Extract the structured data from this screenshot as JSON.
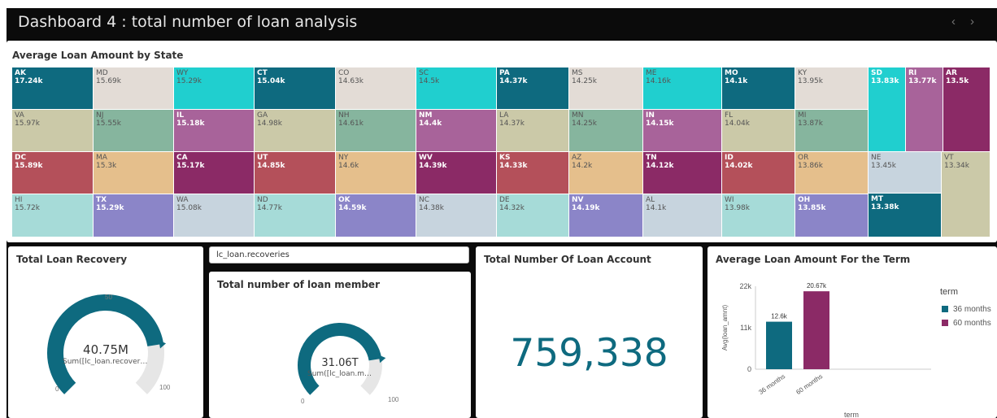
{
  "header": {
    "title": "Dashboard 4 : total number of loan analysis",
    "prev_label": "‹",
    "next_label": "›"
  },
  "colors": {
    "dark_teal": "#0e6a7f",
    "cyan": "#20cfcf",
    "beige": "#e3dcd6",
    "sage": "#86b59e",
    "khaki": "#cbc9a8",
    "mauve": "#a8639a",
    "red": "#b4505a",
    "tan": "#e5bf8c",
    "plum": "#8b2a66",
    "aqua": "#a6dbd8",
    "lavender": "#8b85c8",
    "slate": "#c7d4de",
    "gauge": "#0e6a7f",
    "bar_36": "#0e6a7f",
    "bar_60": "#8b2a66"
  },
  "treemap": {
    "title": "Average Loan Amount by State",
    "tiles": [
      {
        "code": "AK",
        "value": "17.24k",
        "color": "#0e6a7f",
        "dark": true
      },
      {
        "code": "MD",
        "value": "15.69k",
        "color": "#e3dcd6",
        "dark": false
      },
      {
        "code": "WY",
        "value": "15.29k",
        "color": "#20cfcf",
        "dark": false
      },
      {
        "code": "CT",
        "value": "15.04k",
        "color": "#0e6a7f",
        "dark": true
      },
      {
        "code": "CO",
        "value": "14.63k",
        "color": "#e3dcd6",
        "dark": false
      },
      {
        "code": "SC",
        "value": "14.5k",
        "color": "#20cfcf",
        "dark": false
      },
      {
        "code": "PA",
        "value": "14.37k",
        "color": "#0e6a7f",
        "dark": true
      },
      {
        "code": "MS",
        "value": "14.25k",
        "color": "#e3dcd6",
        "dark": false
      },
      {
        "code": "ME",
        "value": "14.16k",
        "color": "#20cfcf",
        "dark": false
      },
      {
        "code": "MO",
        "value": "14.1k",
        "color": "#0e6a7f",
        "dark": true
      },
      {
        "code": "KY",
        "value": "13.95k",
        "color": "#e3dcd6",
        "dark": false
      },
      {
        "code": "VA",
        "value": "15.97k",
        "color": "#cbc9a8",
        "dark": false
      },
      {
        "code": "NJ",
        "value": "15.55k",
        "color": "#86b59e",
        "dark": false
      },
      {
        "code": "IL",
        "value": "15.18k",
        "color": "#a8639a",
        "dark": true
      },
      {
        "code": "GA",
        "value": "14.98k",
        "color": "#cbc9a8",
        "dark": false
      },
      {
        "code": "NH",
        "value": "14.61k",
        "color": "#86b59e",
        "dark": false
      },
      {
        "code": "NM",
        "value": "14.4k",
        "color": "#a8639a",
        "dark": true
      },
      {
        "code": "LA",
        "value": "14.37k",
        "color": "#cbc9a8",
        "dark": false
      },
      {
        "code": "MN",
        "value": "14.25k",
        "color": "#86b59e",
        "dark": false
      },
      {
        "code": "IN",
        "value": "14.15k",
        "color": "#a8639a",
        "dark": true
      },
      {
        "code": "FL",
        "value": "14.04k",
        "color": "#cbc9a8",
        "dark": false
      },
      {
        "code": "MI",
        "value": "13.87k",
        "color": "#86b59e",
        "dark": false
      },
      {
        "code": "DC",
        "value": "15.89k",
        "color": "#b4505a",
        "dark": true
      },
      {
        "code": "MA",
        "value": "15.3k",
        "color": "#e5bf8c",
        "dark": false
      },
      {
        "code": "CA",
        "value": "15.17k",
        "color": "#8b2a66",
        "dark": true
      },
      {
        "code": "UT",
        "value": "14.85k",
        "color": "#b4505a",
        "dark": true
      },
      {
        "code": "NY",
        "value": "14.6k",
        "color": "#e5bf8c",
        "dark": false
      },
      {
        "code": "WV",
        "value": "14.39k",
        "color": "#8b2a66",
        "dark": true
      },
      {
        "code": "KS",
        "value": "14.33k",
        "color": "#b4505a",
        "dark": true
      },
      {
        "code": "AZ",
        "value": "14.2k",
        "color": "#e5bf8c",
        "dark": false
      },
      {
        "code": "TN",
        "value": "14.12k",
        "color": "#8b2a66",
        "dark": true
      },
      {
        "code": "ID",
        "value": "14.02k",
        "color": "#b4505a",
        "dark": true
      },
      {
        "code": "OR",
        "value": "13.86k",
        "color": "#e5bf8c",
        "dark": false
      },
      {
        "code": "HI",
        "value": "15.72k",
        "color": "#a6dbd8",
        "dark": false
      },
      {
        "code": "TX",
        "value": "15.29k",
        "color": "#8b85c8",
        "dark": true
      },
      {
        "code": "WA",
        "value": "15.08k",
        "color": "#c7d4de",
        "dark": false
      },
      {
        "code": "ND",
        "value": "14.77k",
        "color": "#a6dbd8",
        "dark": false
      },
      {
        "code": "OK",
        "value": "14.59k",
        "color": "#8b85c8",
        "dark": true
      },
      {
        "code": "NC",
        "value": "14.38k",
        "color": "#c7d4de",
        "dark": false
      },
      {
        "code": "DE",
        "value": "14.32k",
        "color": "#a6dbd8",
        "dark": false
      },
      {
        "code": "NV",
        "value": "14.19k",
        "color": "#8b85c8",
        "dark": true
      },
      {
        "code": "AL",
        "value": "14.1k",
        "color": "#c7d4de",
        "dark": false
      },
      {
        "code": "WI",
        "value": "13.98k",
        "color": "#a6dbd8",
        "dark": false
      },
      {
        "code": "OH",
        "value": "13.85k",
        "color": "#8b85c8",
        "dark": true
      },
      {
        "code": "SD",
        "value": "13.83k",
        "color": "#20cfcf",
        "dark": true
      },
      {
        "code": "RI",
        "value": "13.77k",
        "color": "#a8639a",
        "dark": true
      },
      {
        "code": "AR",
        "value": "13.5k",
        "color": "#8b2a66",
        "dark": true
      },
      {
        "code": "NE",
        "value": "13.45k",
        "color": "#c7d4de",
        "dark": false
      },
      {
        "code": "VT",
        "value": "13.34k",
        "color": "#cbc9a8",
        "dark": false
      },
      {
        "code": "MT",
        "value": "13.38k",
        "color": "#0e6a7f",
        "dark": true
      }
    ]
  },
  "recovery": {
    "title": "Total Loan Recovery",
    "value": "40.75M",
    "sub": "Sum([lc_loan.recoveri...",
    "fraction": 0.8,
    "tick_min": "0",
    "tick_mid": "50",
    "tick_max": "100"
  },
  "filter": {
    "label": "lc_loan.recoveries"
  },
  "members": {
    "title": "Total number of loan member",
    "value": "31.06T",
    "sub": "Sum([lc_loan.me...",
    "fraction": 0.8,
    "tick_min": "0",
    "tick_max": "100"
  },
  "accounts": {
    "title": "Total Number Of Loan Account",
    "value": "759,338"
  },
  "term_chart": {
    "title": "Average Loan Amount For the Term",
    "legend_title": "term"
  },
  "chart_data": {
    "type": "bar",
    "title": "Average Loan Amount For the Term",
    "categories": [
      "36 months",
      "60 months"
    ],
    "values": [
      12600,
      20670
    ],
    "data_labels": [
      "12.6k",
      "20.67k"
    ],
    "ylabel": "Avg(loan_amnt)",
    "xlabel": "term",
    "ylim": [
      0,
      22000
    ],
    "yticks": [
      {
        "value": 0,
        "label": "0"
      },
      {
        "value": 11000,
        "label": "11k"
      },
      {
        "value": 22000,
        "label": "22k"
      }
    ],
    "legend": [
      "36 months",
      "60 months"
    ],
    "legend_placement": "right",
    "grid": false
  }
}
